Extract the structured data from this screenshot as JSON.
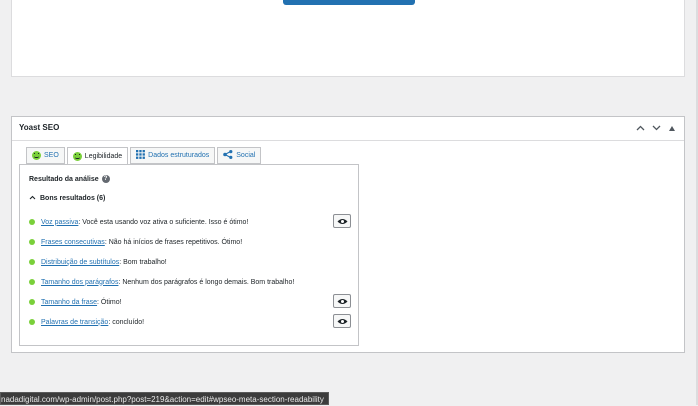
{
  "yoast": {
    "title": "Yoast SEO",
    "tabs": [
      {
        "label": "SEO",
        "icon": "smiley-icon"
      },
      {
        "label": "Legibilidade",
        "icon": "smiley-icon"
      },
      {
        "label": "Dados estruturados",
        "icon": "grid-icon"
      },
      {
        "label": "Social",
        "icon": "share-icon"
      }
    ],
    "analysis_title": "Resultado da análise",
    "good_results_label": "Bons resultados (6)",
    "results": [
      {
        "link": "Voz passiva",
        "text": ": Você esta usando voz ativa o suficiente. Isso é ótimo!",
        "has_eye": true
      },
      {
        "link": "Frases consecutivas",
        "text": ": Não há inícios de frases repetitivos. Ótimo!",
        "has_eye": false
      },
      {
        "link": "Distribuição de subtítulos",
        "text": ": Bom trabalho!",
        "has_eye": false
      },
      {
        "link": "Tamanho dos parágrafos",
        "text": ": Nenhum dos parágrafos é longo demais. Bom trabalho!",
        "has_eye": false
      },
      {
        "link": "Tamanho da frase",
        "text": ": Ótimo!",
        "has_eye": true
      },
      {
        "link": "Palavras de transição",
        "text": ": concluído!",
        "has_eye": true
      }
    ]
  },
  "status_url": "nadadigital.com/wp-admin/post.php?post=219&action=edit#wpseo-meta-section-readability",
  "colors": {
    "accent": "#2271b1",
    "good": "#7ad03a"
  }
}
